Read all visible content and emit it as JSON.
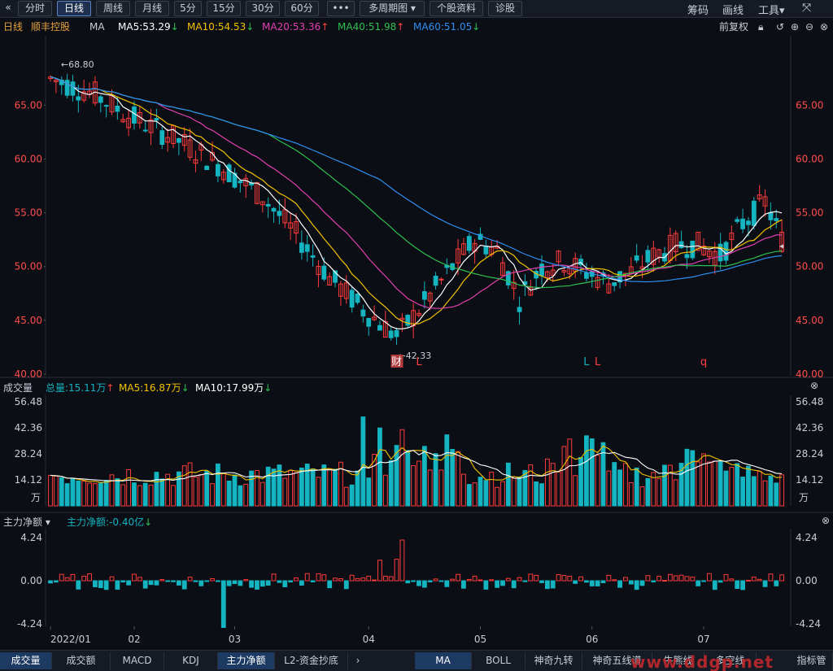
{
  "toolbar": {
    "back_icon": "double-chevron-left",
    "periods": [
      "分时",
      "日线",
      "周线",
      "月线",
      "5分",
      "15分",
      "30分",
      "60分"
    ],
    "active_period": "日线",
    "more_label": "•••",
    "multi_period_label": "多周期图",
    "stock_info_label": "个股资料",
    "diagnose_label": "诊股",
    "right": [
      "筹码",
      "画线",
      "工具"
    ],
    "tools_dropdown_icon": "chevron-down-icon",
    "expand_icon": "fullscreen-icon"
  },
  "legend": {
    "period": "日线",
    "stock_name": "顺丰控股",
    "ma_label": "MA",
    "ma5": "MA5:53.29",
    "ma10": "MA10:54.53",
    "ma20": "MA20:53.36",
    "ma40": "MA40:51.98",
    "ma60": "MA60:51.05",
    "adjust": "前复权",
    "colors": {
      "ma5": "#ffffff",
      "ma10": "#f2c200",
      "ma20": "#e040b0",
      "ma40": "#2ec050",
      "ma60": "#2f8ef0",
      "down_arrow": "#2ec050",
      "up_arrow": "#ff4040"
    }
  },
  "price_axis": {
    "ticks": [
      "65.00",
      "60.00",
      "55.00",
      "50.00",
      "45.00",
      "40.00"
    ],
    "high_label": "68.80",
    "low_label": "42.33",
    "markers": [
      "财",
      "L",
      "L",
      "L",
      "q"
    ]
  },
  "volume_panel": {
    "title": "成交量",
    "total": "总量:15.11万",
    "ma5": "MA5:16.87万",
    "ma10": "MA10:17.99万",
    "ticks": [
      "56.48",
      "42.36",
      "28.24",
      "14.12"
    ],
    "unit": "万"
  },
  "capital_panel": {
    "title": "主力净额",
    "value": "主力净额:-0.40亿",
    "ticks": [
      "4.24",
      "0.00",
      "-4.24"
    ]
  },
  "x_axis": [
    "2022/01",
    "02",
    "03",
    "04",
    "05",
    "06",
    "07"
  ],
  "bottom_tabs": [
    "成交量",
    "成交额",
    "MACD",
    "KDJ",
    "主力净额",
    "L2-资金抄底"
  ],
  "bottom_tabs_right": [
    "MA",
    "BOLL",
    "神奇九转",
    "神奇五线谱",
    "牛熊线",
    "多空线",
    "指标管"
  ],
  "watermark": "www.ddgp.net",
  "colors": {
    "up": "#ff3b3b",
    "down": "#14b4c0",
    "axis_red": "#ff4d4d",
    "bg": "#0b0e15"
  }
}
